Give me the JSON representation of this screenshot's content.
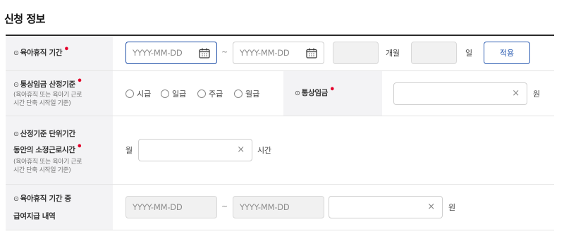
{
  "section_title": "신청 정보",
  "rows": {
    "leave_period": {
      "icon": "⊙",
      "label": "육아휴직 기간",
      "start_placeholder": "YYYY-MM-DD",
      "separator": "~",
      "end_placeholder": "YYYY-MM-DD",
      "months_value": "",
      "months_unit": "개월",
      "days_value": "",
      "days_unit": "일",
      "apply_label": "적용"
    },
    "wage_basis": {
      "icon": "⊙",
      "label": "통상임금 산정기준",
      "note_line1": "(육아휴직 또는 육아기 근로",
      "note_line2": "시간 단축 시작일 기준)",
      "options": [
        "시급",
        "일급",
        "주급",
        "월급"
      ],
      "wage_icon": "⊙",
      "wage_label": "통상임금",
      "wage_value": "",
      "clear": "×",
      "wage_unit": "원"
    },
    "work_hours": {
      "icon": "⊙",
      "label_line1": "산정기준 단위기간",
      "label_line2": "동안의 소정근로시간",
      "note_line1": "(육아휴직 또는 육아기 근로",
      "note_line2": "시간 단축 시작일 기준)",
      "prefix": "월",
      "value": "",
      "clear": "×",
      "unit": "시간"
    },
    "payment_history": {
      "icon": "⊙",
      "label_line1": "육아휴직 기간 중",
      "label_line2": "급여지급 내역",
      "start_placeholder": "YYYY-MM-DD",
      "separator": "~",
      "end_placeholder": "YYYY-MM-DD",
      "amount_value": "",
      "clear": "×",
      "unit": "원"
    }
  },
  "colors": {
    "required": "#e4002b",
    "accent": "#2f5fb3",
    "label_bg": "#f3f3f5"
  },
  "icons": {
    "date": "calendar-icon",
    "clear": "close-icon"
  }
}
